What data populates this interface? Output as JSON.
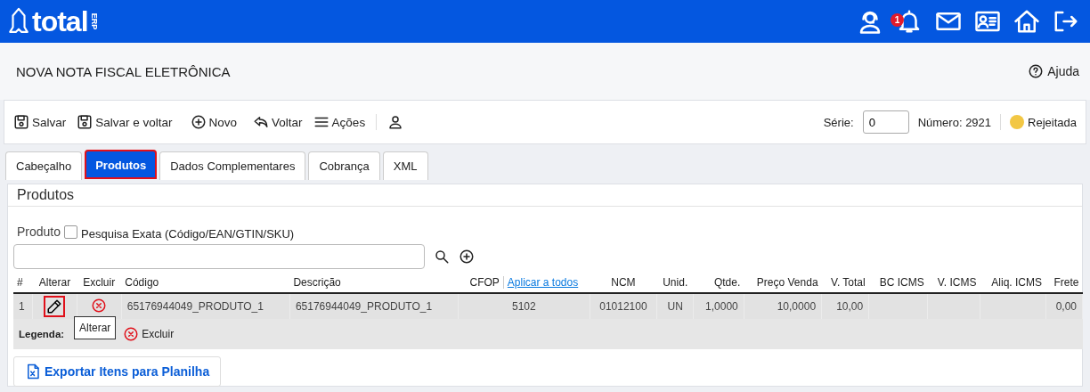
{
  "header": {
    "logo": "total",
    "logo_suffix": "ERP",
    "notification_count": "1"
  },
  "page": {
    "title": "NOVA NOTA FISCAL ELETRÔNICA",
    "help": "Ajuda"
  },
  "toolbar": {
    "items": [
      {
        "kind": "save",
        "label": "Salvar"
      },
      {
        "kind": "save",
        "label": "Salvar e voltar"
      },
      {
        "kind": "new",
        "label": "Novo"
      },
      {
        "kind": "back",
        "label": "Voltar"
      },
      {
        "kind": "menu",
        "label": "Ações"
      },
      {
        "kind": "user"
      }
    ],
    "serie_label": "Série:",
    "serie_value": "0",
    "numero": "Número: 2921",
    "status": {
      "label": "Rejeitada",
      "color": "#f2c744"
    }
  },
  "tabs": [
    {
      "label": "Cabeçalho",
      "selected": false,
      "highlighted": false
    },
    {
      "label": "Produtos",
      "selected": true,
      "highlighted": true
    },
    {
      "label": "Dados Complementares",
      "selected": false,
      "highlighted": false
    },
    {
      "label": "Cobrança",
      "selected": false,
      "highlighted": false
    },
    {
      "label": "XML",
      "selected": false,
      "highlighted": false
    }
  ],
  "panel": {
    "title": "Produtos",
    "product_label": "Produto",
    "exact_search": {
      "label": "Pesquisa Exata (Código/EAN/GTIN/SKU)",
      "checked": false
    },
    "table": {
      "columns": [
        {
          "label": "#",
          "kind": "text"
        },
        {
          "label": "Alterar",
          "kind": "edit"
        },
        {
          "label": "Excluir",
          "kind": "delete"
        },
        {
          "label": "Código",
          "kind": "text"
        },
        {
          "label": "Descrição",
          "kind": "text"
        },
        {
          "label": "CFOP",
          "action": "Aplicar a todos",
          "kind": "text"
        },
        {
          "label": "NCM",
          "kind": "text"
        },
        {
          "label": "Unid.",
          "kind": "text"
        },
        {
          "label": "Qtde.",
          "kind": "text"
        },
        {
          "label": "Preço Venda",
          "kind": "text"
        },
        {
          "label": "V. Total",
          "kind": "text"
        },
        {
          "label": "BC ICMS",
          "kind": "text"
        },
        {
          "label": "V. ICMS",
          "kind": "text"
        },
        {
          "label": "Aliq. ICMS",
          "kind": "text"
        },
        {
          "label": "Frete",
          "kind": "text"
        }
      ],
      "rows": [
        {
          "number": "1",
          "edit_highlighted": true,
          "codigo": "65176944049_PRODUTO_1",
          "descricao": "65176944049_PRODUTO_1",
          "cfop": "5102",
          "ncm": "01012100",
          "unid": "UN",
          "qtde": "1,0000",
          "preco": "10,0000",
          "total": "10,00",
          "frete": "0,00"
        }
      ]
    },
    "legend": {
      "label": "Legenda:",
      "delete_label": "Excluir",
      "tooltip": "Alterar"
    },
    "export_button": "Exportar Itens para Planilha"
  }
}
